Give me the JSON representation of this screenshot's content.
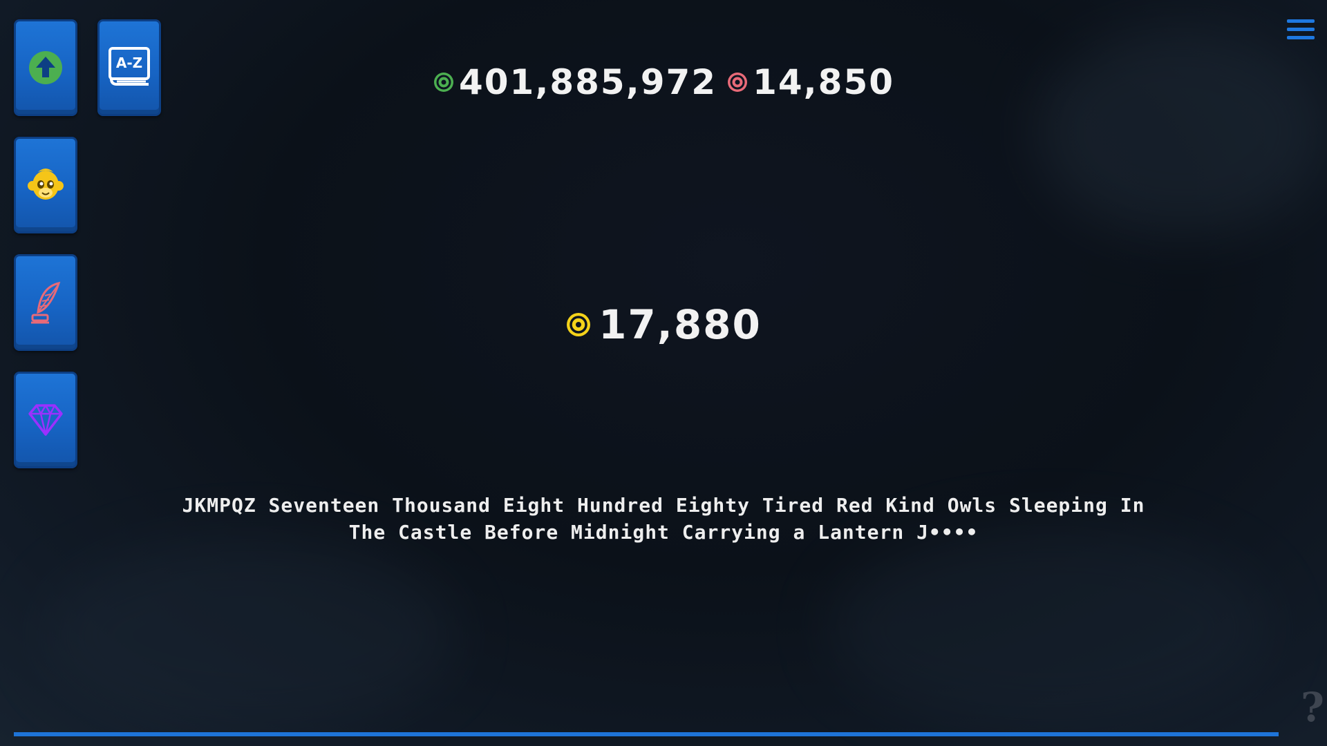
{
  "colors": {
    "accent": "#1e74d6",
    "green_currency": "#4caf50",
    "red_currency": "#e86a78",
    "gold_currency": "#f4d21a"
  },
  "buttons": {
    "upgrade": {
      "icon": "arrow-up-circle-icon"
    },
    "dictionary": {
      "icon": "az-book-icon",
      "label": "A-Z"
    },
    "monkey": {
      "icon": "monkey-face-icon"
    },
    "quill": {
      "icon": "quill-ink-icon"
    },
    "gem": {
      "icon": "diamond-icon"
    }
  },
  "currencies": {
    "green": {
      "value": "401,885,972",
      "icon": "green-target-coin-icon"
    },
    "red": {
      "value": "14,850",
      "icon": "red-target-coin-icon"
    }
  },
  "main": {
    "value": "17,880",
    "icon": "gold-target-coin-icon"
  },
  "sentence": {
    "line1": "JKMPQZ Seventeen Thousand Eight Hundred Eighty Tired Red Kind Owls Sleeping In",
    "line2": "The Castle Before Midnight Carrying a Lantern J••••"
  },
  "menu": {
    "icon": "hamburger-menu-icon"
  },
  "help": {
    "icon": "question-mark-icon",
    "label": "?"
  },
  "progress": {
    "fraction": 1.0
  }
}
